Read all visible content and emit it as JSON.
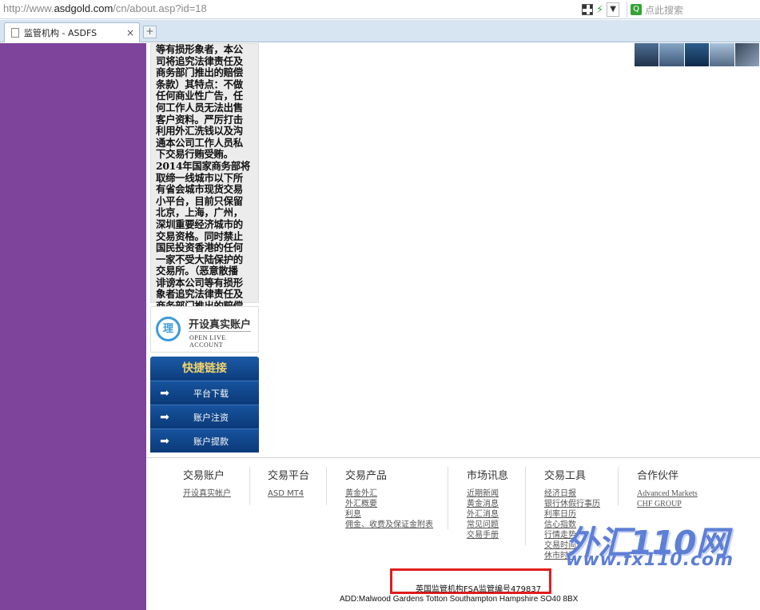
{
  "browser": {
    "url_prefix": "http://www.",
    "url_domain": "asdgold.com",
    "url_path": "/cn/about.asp?id=18",
    "search_placeholder": "点此搜索",
    "tab_title": "监管机构 - ASDFS",
    "tab_close": "×",
    "new_tab": "+"
  },
  "sidebar": {
    "body_text": "等有损形象者，本公\n司将追究法律责任及\n商务部门推出的赔偿\n条款）其特点：不做\n任何商业性广告，任\n何工作人员无法出售\n客户资料。严厉打击\n利用外汇洗钱以及沟\n通本公司工作人员私\n下交易行贿受贿。\n2014年国家商务部将\n取缔一线城市以下所\n有省会城市现货交易\n小平台，目前只保留\n北京，上海，广州，\n深圳重要经济城市的\n交易资格。同时禁止\n国民投资香港的任何\n一家不受大陆保护的\n交易所。（恶意散播\n诽谤本公司等有损形\n象者追究法律责任及\n商务部门推出的赔偿\n条款）",
    "open_account_cn": "开设真实账户",
    "open_account_en": "OPEN LIVE ACCOUNT",
    "quick_links_title": "快捷链接",
    "quick_links": [
      {
        "label": "平台下载"
      },
      {
        "label": "账户注资"
      },
      {
        "label": "账户提款"
      }
    ]
  },
  "footer": {
    "columns": [
      {
        "title": "交易账户",
        "links": [
          "开设真实帐户"
        ]
      },
      {
        "title": "交易平台",
        "links": [
          "ASD MT4"
        ]
      },
      {
        "title": "交易产品",
        "links": [
          "黄金外汇",
          "外汇概要",
          "利息",
          "佣金、收费及保证金附表"
        ]
      },
      {
        "title": "市场讯息",
        "links": [
          "近期新闻",
          "黄金消息",
          "外汇消息",
          "常见问题",
          "交易手册"
        ]
      },
      {
        "title": "交易工具",
        "links": [
          "经济日报",
          "银行休假行事历",
          "利率日历",
          "信心指数",
          "行情走势",
          "交易时间",
          "休市时间"
        ]
      },
      {
        "title": "合作伙伴",
        "links": [
          "Advanced Markets",
          "CHF GROUP"
        ]
      }
    ],
    "fsa_text": "英国监管机构FSA监管编号479837",
    "address": "ADD:Malwood Gardens Totton Southampton Hampshire SO40 8BX"
  },
  "watermark": {
    "line1": "外汇110网",
    "line2": "www.fx110.com"
  },
  "colors": {
    "sidebar_purple": "#7e449b",
    "quick_link_blue": "#0c3d7c",
    "highlight_red": "#e11d1d"
  }
}
